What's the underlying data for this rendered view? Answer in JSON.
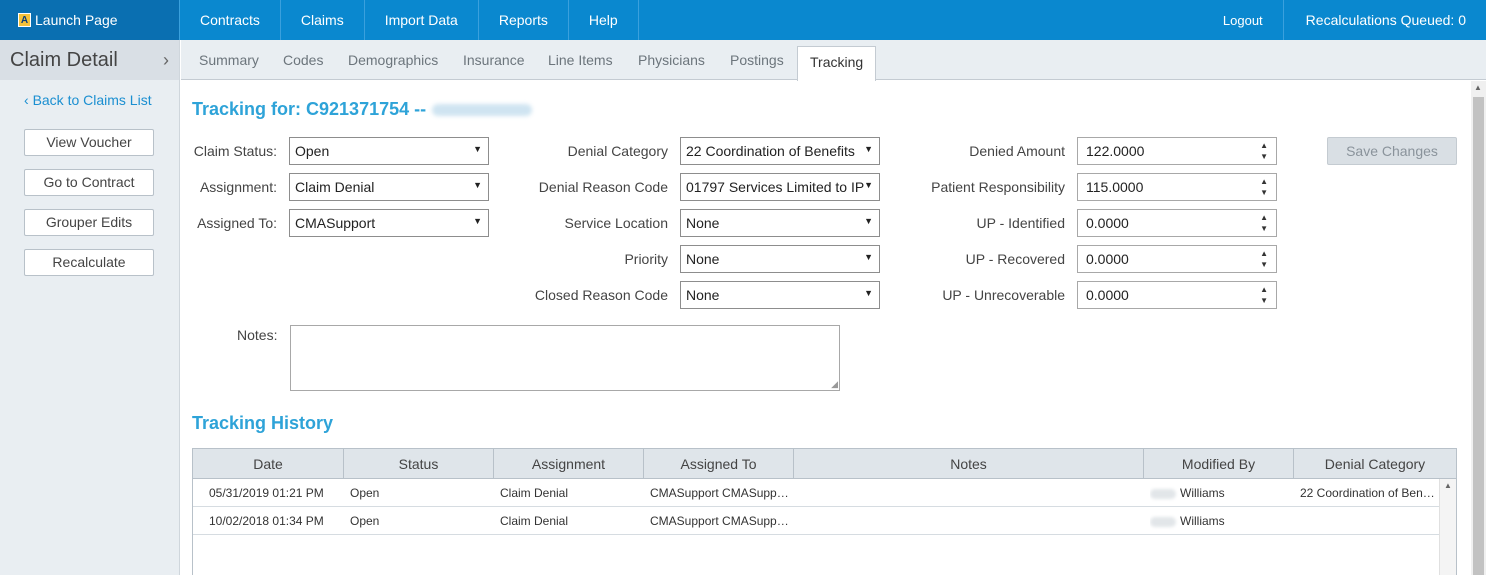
{
  "topnav": {
    "launch_label": "Launch Page",
    "logo_letter": "A",
    "items": [
      "Contracts",
      "Claims",
      "Import Data",
      "Reports",
      "Help"
    ],
    "logout": "Logout",
    "recalc": "Recalculations Queued: 0"
  },
  "sidebar": {
    "title": "Claim Detail",
    "back_link": "Back to Claims List",
    "buttons": [
      "View Voucher",
      "Go to Contract",
      "Grouper Edits",
      "Recalculate"
    ]
  },
  "tabs": [
    "Summary",
    "Codes",
    "Demographics",
    "Insurance",
    "Line Items",
    "Physicians",
    "Postings",
    "Tracking"
  ],
  "active_tab": "Tracking",
  "tracking": {
    "title": "Tracking for: C921371754 --",
    "claim_status": {
      "label": "Claim Status:",
      "value": "Open"
    },
    "assignment": {
      "label": "Assignment:",
      "value": "Claim Denial"
    },
    "assigned_to": {
      "label": "Assigned To:",
      "value": "CMASupport"
    },
    "denial_category": {
      "label": "Denial Category",
      "value": "22 Coordination of Benefits"
    },
    "denial_reason": {
      "label": "Denial Reason Code",
      "value": "01797 Services Limited to IP"
    },
    "service_location": {
      "label": "Service Location",
      "value": "None"
    },
    "priority": {
      "label": "Priority",
      "value": "None"
    },
    "closed_reason": {
      "label": "Closed Reason Code",
      "value": "None"
    },
    "denied_amount": {
      "label": "Denied Amount",
      "value": "122.0000"
    },
    "patient_resp": {
      "label": "Patient Responsibility",
      "value": "115.0000"
    },
    "up_identified": {
      "label": "UP - Identified",
      "value": "0.0000"
    },
    "up_recovered": {
      "label": "UP - Recovered",
      "value": "0.0000"
    },
    "up_unrecoverable": {
      "label": "UP - Unrecoverable",
      "value": "0.0000"
    },
    "save": "Save Changes",
    "notes_label": "Notes:",
    "notes_value": ""
  },
  "history": {
    "title": "Tracking History",
    "columns": [
      "Date",
      "Status",
      "Assignment",
      "Assigned To",
      "Notes",
      "Modified By",
      "Denial Category"
    ],
    "rows": [
      {
        "date": "05/31/2019 01:21 PM",
        "status": "Open",
        "assignment": "Claim Denial",
        "assigned_to": "CMASupport CMASupp…",
        "notes": "",
        "modified_by": "Williams",
        "denial_category": "22 Coordination of Ben…"
      },
      {
        "date": "10/02/2018 01:34 PM",
        "status": "Open",
        "assignment": "Claim Denial",
        "assigned_to": "CMASupport CMASupp…",
        "notes": "",
        "modified_by": "Williams",
        "denial_category": ""
      }
    ]
  },
  "icons": {
    "dropdown_arrow": "▼",
    "spinner_up": "▲",
    "spinner_down": "▼",
    "back_chevron": "‹",
    "collapse_chevron": "›"
  }
}
